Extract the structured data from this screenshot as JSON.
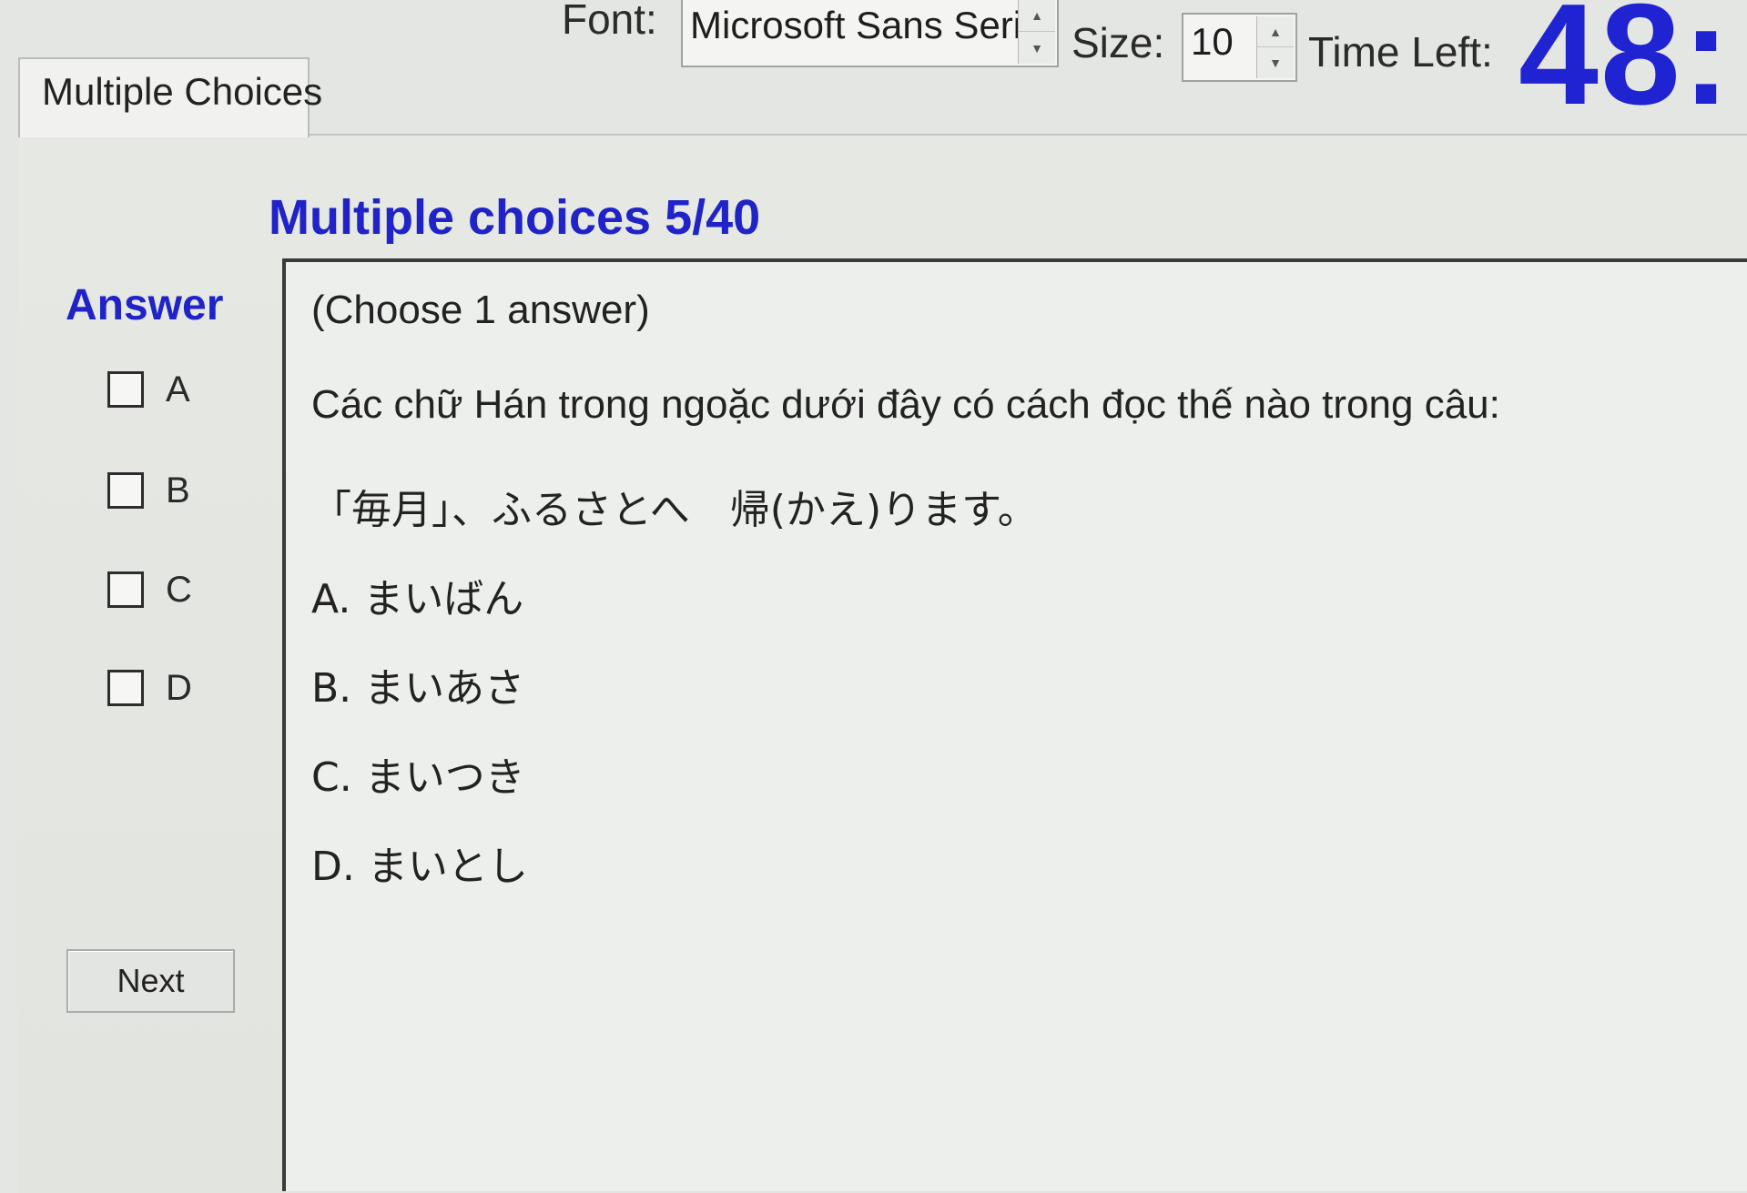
{
  "toolbar": {
    "font_label": "Font:",
    "font_value": "Microsoft Sans Serif",
    "size_label": "Size:",
    "size_value": "10",
    "time_label": "Time Left:",
    "timer_value": "48:"
  },
  "tab": {
    "label": "Multiple Choices"
  },
  "main": {
    "title": "Multiple choices 5/40",
    "answer_heading": "Answer",
    "options": [
      {
        "label": "A"
      },
      {
        "label": "B"
      },
      {
        "label": "C"
      },
      {
        "label": "D"
      }
    ],
    "next_label": "Next"
  },
  "question": {
    "instruction": "(Choose 1 answer)",
    "text": "Các chữ Hán trong ngoặc dưới đây có cách đọc thế nào trong câu:",
    "sentence": "「毎月」、ふるさとへ　帰(かえ)ります。",
    "choices": [
      "A. まいばん",
      "B. まいあさ",
      "C. まいつき",
      "D. まいとし"
    ]
  },
  "colors": {
    "accent_blue": "#1f23c8",
    "timer_blue": "#1f23d1",
    "background": "#e3e6e2"
  },
  "icons": {
    "spin_up": "spin-up-icon",
    "spin_down": "spin-down-icon",
    "checkbox": "checkbox-icon"
  }
}
